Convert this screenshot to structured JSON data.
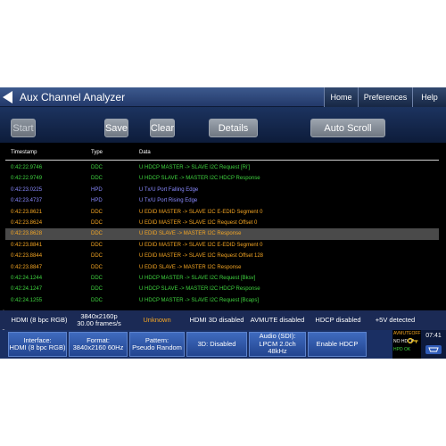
{
  "header": {
    "title": "Aux Channel Analyzer",
    "buttons": [
      "Home",
      "Preferences",
      "Help"
    ]
  },
  "toolbar": {
    "start_label": "Start",
    "save_label": "Save",
    "clear_label": "Clear",
    "details_label": "Details",
    "autoscroll_label": "Auto Scroll"
  },
  "log": {
    "columns": [
      "Timestamp",
      "Type",
      "Data"
    ],
    "rows": [
      {
        "ts": "0:42:22.9746",
        "type": "DDC",
        "data": "U HDCP  MASTER -> SLAVE I2C Request [Ri']",
        "color": "#3fd43f"
      },
      {
        "ts": "0:42:22.9749",
        "type": "DDC",
        "data": "U HDCP  SLAVE -> MASTER I2C HDCP Response",
        "color": "#3fd43f"
      },
      {
        "ts": "0:42:23.0225",
        "type": "HPD",
        "data": "U Tx/U Port Falling Edge",
        "color": "#8a8aff"
      },
      {
        "ts": "0:42:23.4737",
        "type": "HPD",
        "data": "U Tx/U Port Rising Edge",
        "color": "#8a8aff"
      },
      {
        "ts": "0:42:23.8621",
        "type": "DDC",
        "data": "U EDID  MASTER -> SLAVE I2C E-EDID Segment 0",
        "color": "#f5a623"
      },
      {
        "ts": "0:42:23.8624",
        "type": "DDC",
        "data": "U EDID  MASTER -> SLAVE I2C Request Offset 0",
        "color": "#f5a623"
      },
      {
        "ts": "0:42:23.8628",
        "type": "DDC",
        "data": "U EDID  SLAVE -> MASTER I2C Response",
        "color": "#f5a623",
        "selected": true
      },
      {
        "ts": "0:42:23.8841",
        "type": "DDC",
        "data": "U EDID  MASTER -> SLAVE I2C E-EDID Segment 0",
        "color": "#f5a623"
      },
      {
        "ts": "0:42:23.8844",
        "type": "DDC",
        "data": "U EDID  MASTER -> SLAVE I2C Request Offset 128",
        "color": "#f5a623"
      },
      {
        "ts": "0:42:23.8847",
        "type": "DDC",
        "data": "U EDID  SLAVE -> MASTER I2C Response",
        "color": "#f5a623"
      },
      {
        "ts": "0:42:24.1244",
        "type": "DDC",
        "data": "U HDCP  MASTER -> SLAVE I2C Request [Bksv]",
        "color": "#3fd43f"
      },
      {
        "ts": "0:42:24.1247",
        "type": "DDC",
        "data": "U HDCP  SLAVE -> MASTER I2C HDCP Response",
        "color": "#3fd43f"
      },
      {
        "ts": "0:42:24.1255",
        "type": "DDC",
        "data": "U HDCP  MASTER -> SLAVE I2C Request [Bcaps]",
        "color": "#3fd43f"
      }
    ]
  },
  "status_in": {
    "label_letters": [
      "I",
      "N"
    ],
    "interface": "HDMI (8 bpc RGB)",
    "resolution_line1": "3840x2160p",
    "resolution_line2": "30.00 frames/s",
    "unknown": "Unknown",
    "mode_3d": "HDMI 3D disabled",
    "avmute": "AVMUTE disabled",
    "hdcp": "HDCP disabled",
    "plus5v": "+5V detected",
    "unknown_color": "#f5a623"
  },
  "status_out": {
    "label_letters": [
      "O",
      "U",
      "T"
    ],
    "interface_label": "Interface:",
    "interface_value": "HDMI (8 bpc RGB)",
    "format_label": "Format:",
    "format_value": "3840x2160 60Hz",
    "pattern_label": "Pattern:",
    "pattern_value": "Pseudo Random",
    "d3_label": "3D: Disabled",
    "audio_label": "Audio (SDI):",
    "audio_line2": "LPCM 2.0ch",
    "audio_line3": "48kHz",
    "enable_hdcp_label": "Enable HDCP",
    "hdcp_avmute": "AVMUTEOFF",
    "hdcp_status": "NO HDCP",
    "hpd_status": "HPD OK",
    "clock": "07:41",
    "key_icon": "key-icon",
    "hdmi_icon": "hdmi-connector-icon"
  }
}
